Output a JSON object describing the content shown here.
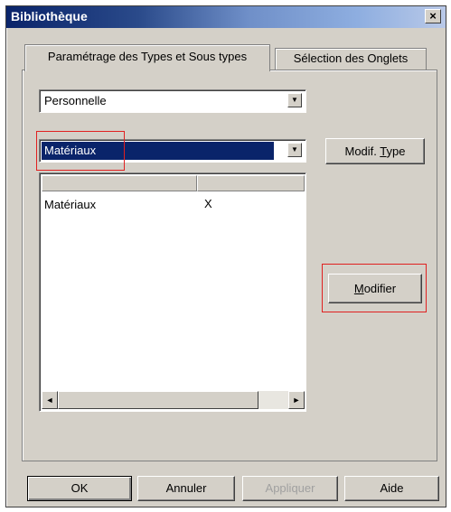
{
  "window": {
    "title": "Bibliothèque",
    "close_glyph": "×"
  },
  "tabs": [
    {
      "label": "Paramétrage des Types et Sous types",
      "active": true
    },
    {
      "label": "Sélection des Onglets",
      "active": false
    }
  ],
  "combo_library": {
    "value": "Personnelle"
  },
  "combo_type": {
    "value": "Matériaux"
  },
  "buttons": {
    "modif_type": {
      "pre": "Modif. ",
      "accel": "T",
      "post": "ype"
    },
    "modifier": {
      "pre": "",
      "accel": "M",
      "post": "odifier"
    }
  },
  "list": {
    "rows": [
      {
        "name": "Matériaux",
        "value": "X"
      }
    ]
  },
  "scroll": {
    "left_arrow": "◄",
    "right_arrow": "►"
  },
  "combo_arrow": "▼",
  "footer": {
    "ok": "OK",
    "annuler": "Annuler",
    "appliquer": "Appliquer",
    "aide": "Aide"
  },
  "colors": {
    "highlight": "#0a246a",
    "annotation": "#e02020",
    "face": "#d4d0c8"
  }
}
